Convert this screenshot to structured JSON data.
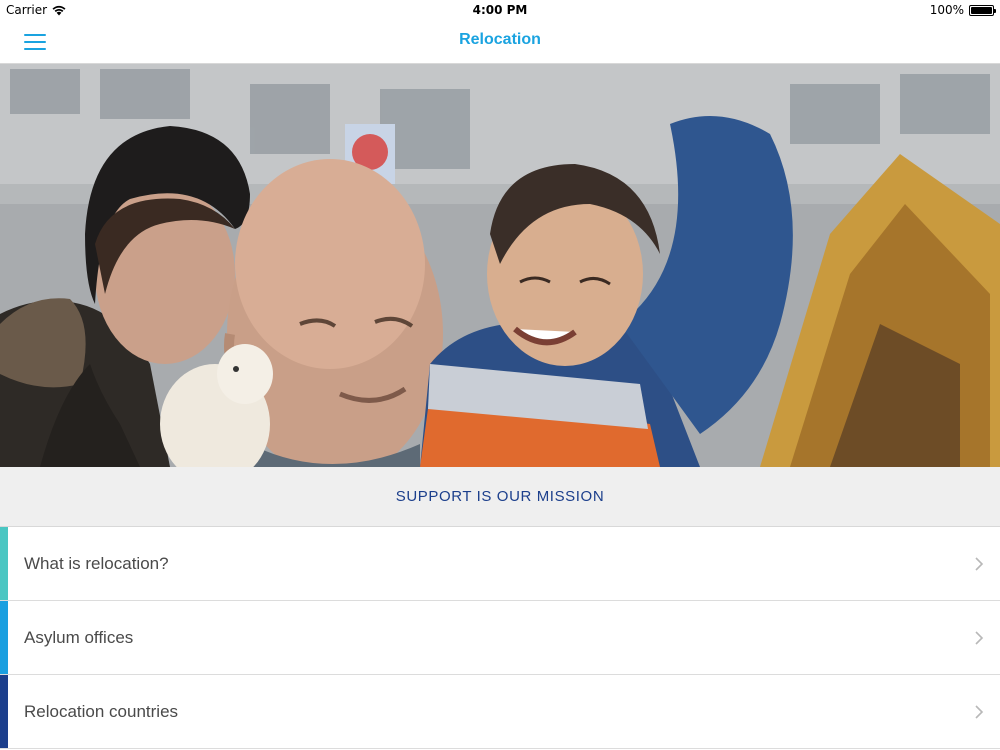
{
  "status_bar": {
    "carrier": "Carrier",
    "time": "4:00 PM",
    "battery_label": "100%",
    "battery_level": 1.0
  },
  "nav": {
    "title": "Relocation",
    "menu_icon": "hamburger-menu-icon"
  },
  "hero": {
    "image_description": "photo"
  },
  "mission": {
    "text": "SUPPORT IS OUR MISSION"
  },
  "menu": {
    "items": [
      {
        "label": "What is relocation?",
        "accent": "#4ac6c2",
        "icon": "chevron-right-icon"
      },
      {
        "label": "Asylum offices",
        "accent": "#1a9fe0",
        "icon": "chevron-right-icon"
      },
      {
        "label": "Relocation countries",
        "accent": "#1c3f8c",
        "icon": "chevron-right-icon"
      }
    ]
  },
  "colors": {
    "brand_blue": "#1aa3e0",
    "mission_text": "#1c3f8c",
    "band_bg": "#efefef"
  }
}
